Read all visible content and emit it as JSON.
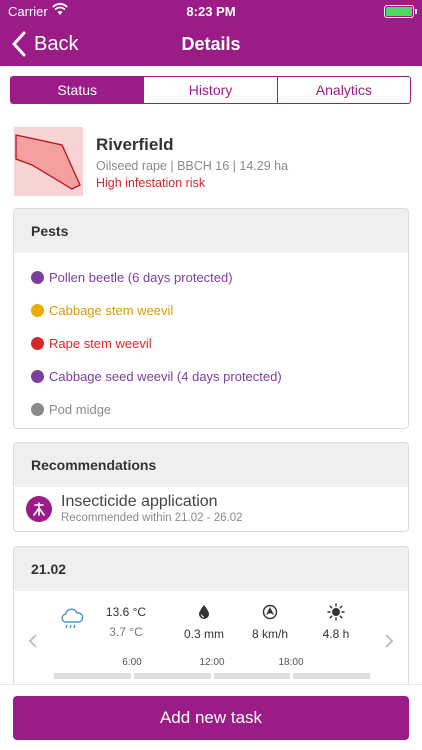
{
  "status_bar": {
    "carrier": "Carrier",
    "time": "8:23 PM"
  },
  "nav": {
    "back_label": "Back",
    "title": "Details"
  },
  "tabs": [
    {
      "label": "Status",
      "active": true
    },
    {
      "label": "History",
      "active": false
    },
    {
      "label": "Analytics",
      "active": false
    }
  ],
  "field": {
    "name": "Riverfield",
    "meta": "Oilseed rape | BBCH 16 | 14.29 ha",
    "risk": "High infestation risk"
  },
  "pests": {
    "header": "Pests",
    "items": [
      {
        "label": "Pollen beetle (6 days protected)",
        "color": "#7b3f9c"
      },
      {
        "label": "Cabbage stem weevil",
        "color": "#e8ad00"
      },
      {
        "label": "Rape stem weevil",
        "color": "#d8262a"
      },
      {
        "label": "Cabbage seed weevil (4 days protected)",
        "color": "#7b3f9c"
      },
      {
        "label": "Pod midge",
        "color": "#8a8a8a"
      }
    ]
  },
  "recommendations": {
    "header": "Recommendations",
    "item": {
      "title": "Insecticide application",
      "subtitle": "Recommended within 21.02 - 26.02",
      "icon": "sprayer-icon"
    }
  },
  "weather": {
    "date": "21.02",
    "temp_high": "13.6 °C",
    "temp_low": "3.7 °C",
    "precipitation": "0.3 mm",
    "wind": "8 km/h",
    "sunshine": "4.8 h",
    "times": [
      "6:00",
      "12:00",
      "18:00"
    ]
  },
  "footer": {
    "add_task_label": "Add new task"
  },
  "colors": {
    "accent": "#9c1c87",
    "risk": "#d8262a"
  }
}
